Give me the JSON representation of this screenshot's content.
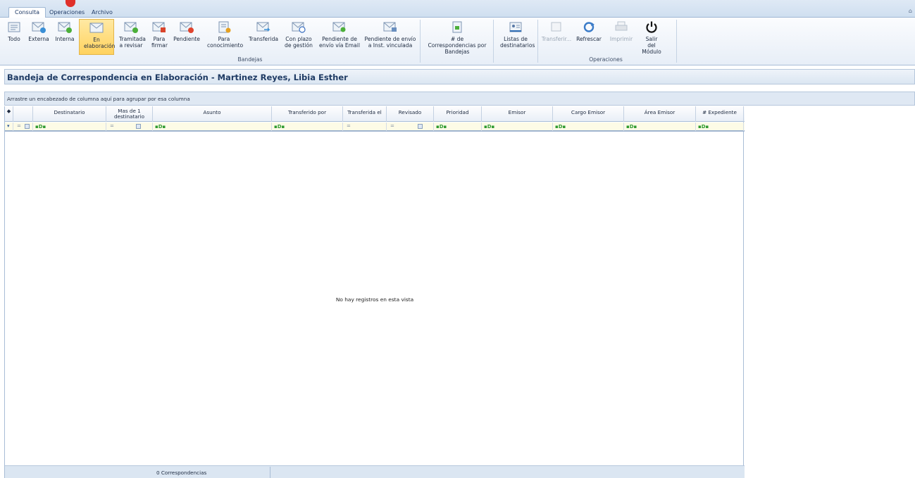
{
  "tabs": [
    "Consulta",
    "Operaciones",
    "Archivo"
  ],
  "ribbon": {
    "bandejas": [
      {
        "label": "Todo",
        "icon": "envelope-list-icon"
      },
      {
        "label": "Externa",
        "icon": "envelope-external-icon"
      },
      {
        "label": "Interna",
        "icon": "envelope-internal-icon"
      },
      {
        "label": "En elaboración",
        "icon": "envelope-draft-icon",
        "selected": true
      },
      {
        "label": "Tramitada a revisar",
        "icon": "envelope-check-icon"
      },
      {
        "label": "Para firmar",
        "icon": "envelope-sign-icon"
      },
      {
        "label": "Pendiente",
        "icon": "envelope-pending-icon"
      },
      {
        "label": "Para conocimiento",
        "icon": "document-info-icon"
      },
      {
        "label": "Transferida",
        "icon": "envelope-transfer-icon"
      },
      {
        "label": "Con plazo de gestión",
        "icon": "envelope-clock-icon"
      },
      {
        "label": "Pendiente de envío vía Email",
        "icon": "envelope-email-icon"
      },
      {
        "label": "Pendiente de envío a Inst. vinculada",
        "icon": "envelope-institution-icon"
      },
      {
        "label": "# de Correspondencias por Bandejas",
        "icon": "document-count-icon"
      },
      {
        "label": "Listas de destinatarios",
        "icon": "contacts-list-icon"
      }
    ],
    "bandejas_group": "Bandejas",
    "operaciones": [
      {
        "label": "Transferir...",
        "icon": "transfer-icon",
        "disabled": true
      },
      {
        "label": "Refrescar",
        "icon": "refresh-icon"
      },
      {
        "label": "Imprimir",
        "icon": "printer-icon",
        "disabled": true
      },
      {
        "label": "Salir del Módulo",
        "icon": "power-icon"
      }
    ],
    "operaciones_group": "Operaciones"
  },
  "page_title": "Bandeja de Correspondencia en Elaboración - Martinez Reyes, Libia Esther",
  "group_hint": "Arrastre un encabezado de columna aquí para agrupar por esa columna",
  "columns": [
    "Destinatario",
    "Mas de 1 destinatario",
    "Asunto",
    "Transferido por",
    "Transferida el",
    "Revisado",
    "Prioridad",
    "Emisor",
    "Cargo Emisor",
    "Área Emisor",
    "# Expediente"
  ],
  "empty_message": "No hay registros en esta vista",
  "footer": {
    "count": "0 Correspondencias"
  }
}
